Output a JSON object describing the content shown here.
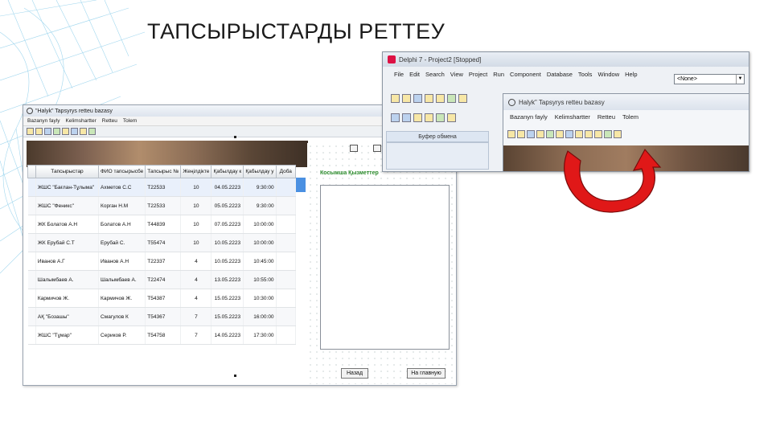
{
  "slide": {
    "title": "ТАПСЫРЫСТАРДЫ РЕТТЕУ"
  },
  "main_window": {
    "title": "\"Halyk\" Tapsyrys retteu bazasy",
    "menu": [
      "Bazanyn fayly",
      "Kelimshartter",
      "Retteu",
      "Tolem"
    ]
  },
  "grid": {
    "columns": [
      "Тапсырыстар",
      "ФИО тапсырысбе",
      "Тапсырыс №",
      "Жеңілдікте",
      "Қабылдау к",
      "Қабылдау у",
      "Доба"
    ],
    "rows": [
      [
        "ЖШС \"Бағлан-Тұлыма\"",
        "Ахметов С.С",
        "Т22533",
        "10",
        "04.05.2223",
        "9:30:00"
      ],
      [
        "ЖШС \"Феникс\"",
        "Корган Н.М",
        "Т22533",
        "10",
        "05.05.2223",
        "9:30:00"
      ],
      [
        "ЖК Болатов А.Н",
        "Болатов А.Н",
        "Т44839",
        "10",
        "07.05.2223",
        "10:00:00"
      ],
      [
        "ЖК Ерубай С.Т",
        "Ерубай С.",
        "Т55474",
        "10",
        "10.05.2223",
        "10:00:00"
      ],
      [
        "Иванов А.Г",
        "Иванов А.Н",
        "Т22337",
        "4",
        "10.05.2223",
        "10:45:00"
      ],
      [
        "Шалымбаев А.",
        "Шалымбаев А.",
        "Т22474",
        "4",
        "13.05.2223",
        "10:55:00"
      ],
      [
        "Кармичов Ж.",
        "Кармичов Ж.",
        "Т54387",
        "4",
        "15.05.2223",
        "10:30:00"
      ],
      [
        "АҚ \"Бозашы\"",
        "Смагулов К",
        "Т54367",
        "7",
        "15.05.2223",
        "16:00:00"
      ],
      [
        "ЖШС \"Тұмар\"",
        "Сериков Р.",
        "Т54758",
        "7",
        "14.05.2223",
        "17:30:00"
      ]
    ]
  },
  "form_designer": {
    "label": "Косымша Қызметтер",
    "buttons": [
      "Назад",
      "На главную"
    ]
  },
  "ide": {
    "title": "Delphi 7 - Project2 [Stopped]",
    "menu": [
      "File",
      "Edit",
      "Search",
      "View",
      "Project",
      "Run",
      "Component",
      "Database",
      "Tools",
      "Window",
      "Help"
    ],
    "combo_value": "<None>",
    "clipboard_label": "Буфер обмена"
  },
  "inner_window": {
    "title": "Halyk\" Tapsyrys retteu bazasy",
    "menu": [
      "Bazanyn fayly",
      "Kelimshartter",
      "Retteu",
      "Tolem"
    ]
  },
  "colors": {
    "arrow": "#e01818",
    "accent_blue": "#4a90e2",
    "green_label": "#2a8a2a"
  }
}
